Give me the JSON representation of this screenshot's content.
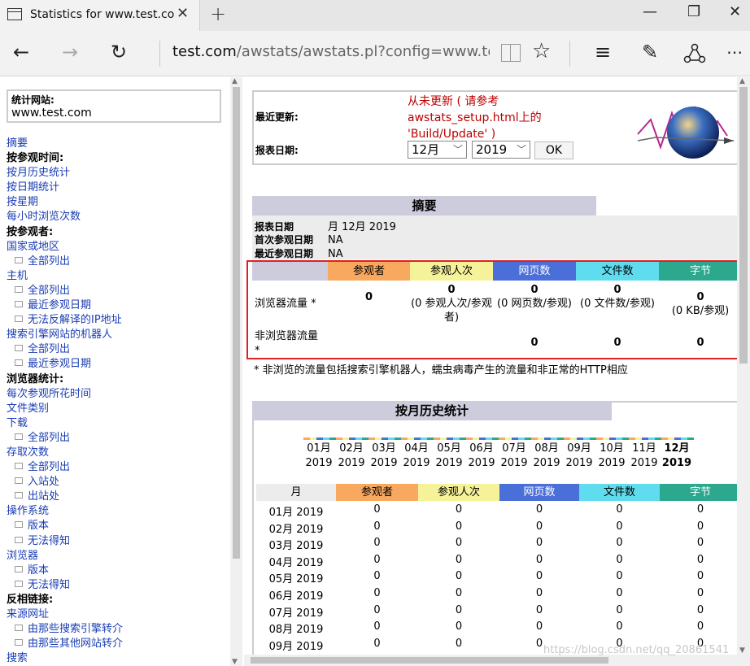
{
  "browser": {
    "tab_title": "Statistics for www.test.co",
    "url_host": "test.com",
    "url_path": "/awstats/awstats.pl?config=www.test."
  },
  "sidebar": {
    "site_label": "统计网站:",
    "site_value": "www.test.com",
    "items": [
      {
        "type": "link",
        "label": "摘要"
      },
      {
        "type": "head",
        "label": "按参观时间:"
      },
      {
        "type": "link",
        "label": "按月历史统计"
      },
      {
        "type": "link",
        "label": "按日期统计"
      },
      {
        "type": "link",
        "label": "按星期"
      },
      {
        "type": "link",
        "label": "每小时浏览次数"
      },
      {
        "type": "head",
        "label": "按参观者:"
      },
      {
        "type": "link",
        "label": "国家或地区"
      },
      {
        "type": "sub",
        "label": "全部列出"
      },
      {
        "type": "link",
        "label": "主机"
      },
      {
        "type": "sub",
        "label": "全部列出"
      },
      {
        "type": "sub",
        "label": "最近参观日期"
      },
      {
        "type": "sub",
        "label": "无法反解译的IP地址"
      },
      {
        "type": "link",
        "label": "搜索引擎网站的机器人"
      },
      {
        "type": "sub",
        "label": "全部列出"
      },
      {
        "type": "sub",
        "label": "最近参观日期"
      },
      {
        "type": "head",
        "label": "浏览器统计:"
      },
      {
        "type": "link",
        "label": "每次参观所花时间"
      },
      {
        "type": "link",
        "label": "文件类别"
      },
      {
        "type": "link",
        "label": "下载"
      },
      {
        "type": "sub",
        "label": "全部列出"
      },
      {
        "type": "link",
        "label": "存取次数"
      },
      {
        "type": "sub",
        "label": "全部列出"
      },
      {
        "type": "sub",
        "label": "入站处"
      },
      {
        "type": "sub",
        "label": "出站处"
      },
      {
        "type": "link",
        "label": "操作系统"
      },
      {
        "type": "sub",
        "label": "版本"
      },
      {
        "type": "sub",
        "label": "无法得知"
      },
      {
        "type": "link",
        "label": "浏览器"
      },
      {
        "type": "sub",
        "label": "版本"
      },
      {
        "type": "sub",
        "label": "无法得知"
      },
      {
        "type": "head",
        "label": "反相链接:"
      },
      {
        "type": "link",
        "label": "来源网址"
      },
      {
        "type": "sub",
        "label": "由那些搜索引擎转介"
      },
      {
        "type": "sub",
        "label": "由那些其他网站转介"
      },
      {
        "type": "link",
        "label": "搜索"
      }
    ]
  },
  "info": {
    "last_update_label": "最近更新:",
    "last_update_text": "从未更新 ( 请参考 awstats_setup.html上的 'Build/Update' )",
    "report_date_label": "报表日期:",
    "month_select": "12月",
    "year_select": "2019",
    "ok_label": "OK"
  },
  "summary": {
    "title": "摘要",
    "report_date_label": "报表日期",
    "report_date_value": "月 12月 2019",
    "first_visit_label": "首次参观日期",
    "first_visit_value": "NA",
    "last_visit_label": "最近参观日期",
    "last_visit_value": "NA",
    "columns": [
      "参观者",
      "参观人次",
      "网页数",
      "文件数",
      "字节"
    ],
    "column_colors": [
      "#f9a860",
      "#f5f29a",
      "#4b6fd8",
      "#5fdcee",
      "#2ba88e"
    ],
    "browser_row": {
      "label": "浏览器流量 *",
      "values": [
        "0",
        "0",
        "0",
        "0",
        "0"
      ],
      "subs": [
        "",
        "(0 参观人次/参观者)",
        "(0 网页数/参观)",
        "(0 文件数/参观)",
        "(0 KB/参观)"
      ]
    },
    "nonbrowser_row": {
      "label": "非浏览器流量 *",
      "values": [
        "",
        "",
        "0",
        "0",
        "0"
      ]
    },
    "footnote": "* 非浏览的流量包括搜索引擎机器人，蠕虫病毒产生的流量和非正常的HTTP相应"
  },
  "monthly": {
    "title": "按月历史统计",
    "months": [
      "01月",
      "02月",
      "03月",
      "04月",
      "05月",
      "06月",
      "07月",
      "08月",
      "09月",
      "10月",
      "11月",
      "12月"
    ],
    "year": "2019",
    "table_month_header": "月",
    "rows": [
      {
        "month": "01月 2019",
        "values": [
          "0",
          "0",
          "0",
          "0",
          "0"
        ]
      },
      {
        "month": "02月 2019",
        "values": [
          "0",
          "0",
          "0",
          "0",
          "0"
        ]
      },
      {
        "month": "03月 2019",
        "values": [
          "0",
          "0",
          "0",
          "0",
          "0"
        ]
      },
      {
        "month": "04月 2019",
        "values": [
          "0",
          "0",
          "0",
          "0",
          "0"
        ]
      },
      {
        "month": "05月 2019",
        "values": [
          "0",
          "0",
          "0",
          "0",
          "0"
        ]
      },
      {
        "month": "06月 2019",
        "values": [
          "0",
          "0",
          "0",
          "0",
          "0"
        ]
      },
      {
        "month": "07月 2019",
        "values": [
          "0",
          "0",
          "0",
          "0",
          "0"
        ]
      },
      {
        "month": "08月 2019",
        "values": [
          "0",
          "0",
          "0",
          "0",
          "0"
        ]
      },
      {
        "month": "09月 2019",
        "values": [
          "0",
          "0",
          "0",
          "0",
          "0"
        ]
      }
    ]
  },
  "watermark": "https://blog.csdn.net/qq_20861541"
}
